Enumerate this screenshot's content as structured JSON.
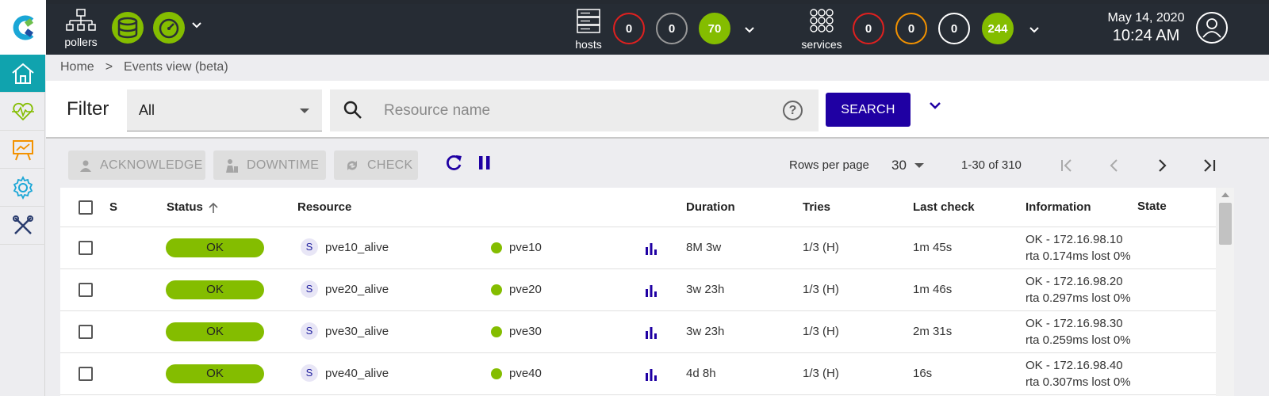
{
  "topbar": {
    "pollers_label": "pollers",
    "hosts": {
      "label": "hosts",
      "down": "0",
      "unreachable": "0",
      "up": "70"
    },
    "services": {
      "label": "services",
      "critical": "0",
      "warning": "0",
      "unknown": "0",
      "ok": "244"
    },
    "date": "May 14, 2020",
    "time": "10:24 AM"
  },
  "sidebar": {
    "items": [
      "home-icon",
      "monitoring-icon",
      "reporting-icon",
      "configuration-icon",
      "administration-icon"
    ]
  },
  "breadcrumb": {
    "home": "Home",
    "separator": ">",
    "current": "Events view (beta)"
  },
  "filter": {
    "label": "Filter",
    "selected": "All",
    "search_placeholder": "Resource name",
    "help": "?",
    "search_button": "SEARCH"
  },
  "actions": {
    "acknowledge": "ACKNOWLEDGE",
    "downtime": "DOWNTIME",
    "check": "CHECK"
  },
  "pagination": {
    "rows_per_page_label": "Rows per page",
    "rows_per_page": "30",
    "range": "1-30 of 310"
  },
  "table": {
    "headers": {
      "s": "S",
      "status": "Status",
      "resource": "Resource",
      "duration": "Duration",
      "tries": "Tries",
      "last_check": "Last check",
      "information": "Information",
      "state": "State"
    },
    "rows": [
      {
        "status": "OK",
        "type": "S",
        "resource": "pve10_alive",
        "host": "pve10",
        "duration": "8M 3w",
        "tries": "1/3 (H)",
        "last_check": "1m 45s",
        "info1": "OK - 172.16.98.10",
        "info2": "rta 0.174ms lost 0%"
      },
      {
        "status": "OK",
        "type": "S",
        "resource": "pve20_alive",
        "host": "pve20",
        "duration": "3w 23h",
        "tries": "1/3 (H)",
        "last_check": "1m 46s",
        "info1": "OK - 172.16.98.20",
        "info2": "rta 0.297ms lost 0%"
      },
      {
        "status": "OK",
        "type": "S",
        "resource": "pve30_alive",
        "host": "pve30",
        "duration": "3w 23h",
        "tries": "1/3 (H)",
        "last_check": "2m 31s",
        "info1": "OK - 172.16.98.30",
        "info2": "rta 0.259ms lost 0%"
      },
      {
        "status": "OK",
        "type": "S",
        "resource": "pve40_alive",
        "host": "pve40",
        "duration": "4d 8h",
        "tries": "1/3 (H)",
        "last_check": "16s",
        "info1": "OK - 172.16.98.40",
        "info2": "rta 0.307ms lost 0%"
      }
    ]
  },
  "colors": {
    "topbar": "#262c34",
    "ok_green": "#84bd00",
    "primary": "#1f00a3",
    "sidebar_active": "#10a3ae",
    "down_red": "#e0201f",
    "warning_orange": "#f39200"
  }
}
